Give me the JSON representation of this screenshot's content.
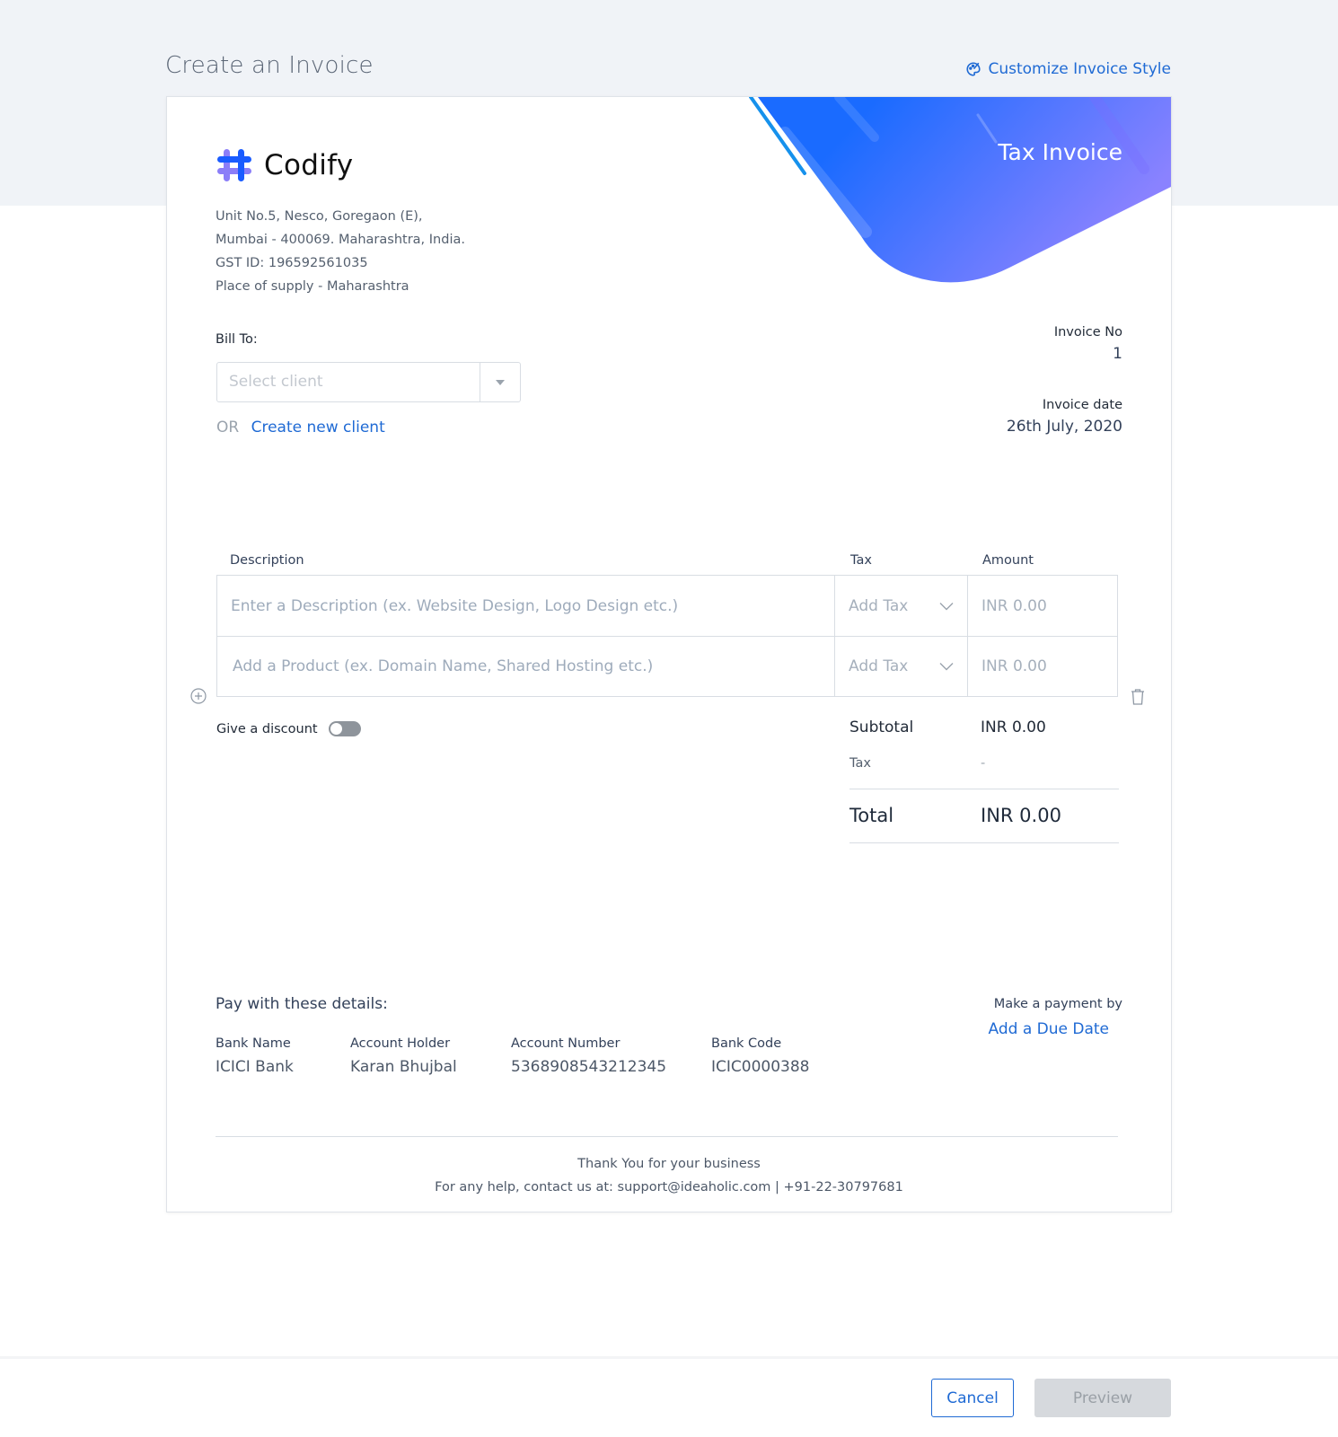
{
  "header": {
    "title": "Create an Invoice",
    "customize_link": "Customize Invoice Style",
    "customize_icon": "palette-icon"
  },
  "invoice": {
    "banner_title": "Tax Invoice",
    "colors": {
      "accent": "#1f6ad4",
      "banner_start": "#1a6bff",
      "banner_end": "#8a82ff"
    },
    "company": {
      "name": "Codify",
      "logo_icon": "hash-logo-icon",
      "address_lines": [
        "Unit No.5, Nesco, Goregaon (E),",
        "Mumbai - 400069. Maharashtra, India.",
        "GST ID: 196592561035",
        "Place of supply - Maharashtra"
      ]
    },
    "bill_to": {
      "label": "Bill To:",
      "select_placeholder": "Select client",
      "or_text": "OR",
      "create_client_link": "Create new client"
    },
    "meta": {
      "invoice_no_label": "Invoice No",
      "invoice_no_value": "1",
      "invoice_date_label": "Invoice date",
      "invoice_date_value": "26th July, 2020"
    },
    "items": {
      "headers": {
        "description": "Description",
        "tax": "Tax",
        "amount": "Amount"
      },
      "rows": [
        {
          "description_placeholder": "Enter a Description (ex. Website Design, Logo Design etc.)",
          "tax_placeholder": "Add Tax",
          "amount_placeholder": "INR 0.00"
        },
        {
          "description_placeholder": "Add a Product (ex. Domain Name, Shared Hosting etc.)",
          "tax_placeholder": "Add Tax",
          "amount_placeholder": "INR 0.00"
        }
      ],
      "add_row_icon": "plus-circle-icon",
      "delete_row_icon": "trash-icon"
    },
    "discount": {
      "label": "Give a discount",
      "enabled": false
    },
    "totals": {
      "subtotal_label": "Subtotal",
      "subtotal_value": "INR 0.00",
      "tax_label": "Tax",
      "tax_value": "-",
      "total_label": "Total",
      "total_value": "INR 0.00"
    },
    "payment": {
      "title": "Pay with these details:",
      "bank_name_label": "Bank Name",
      "bank_name_value": "ICICI Bank",
      "account_holder_label": "Account Holder",
      "account_holder_value": "Karan Bhujbal",
      "account_number_label": "Account Number",
      "account_number_value": "5368908543212345",
      "bank_code_label": "Bank Code",
      "bank_code_value": "ICIC0000388",
      "due_label": "Make a payment by",
      "due_link": "Add a Due Date"
    },
    "footer": {
      "thanks": "Thank You for your business",
      "contact": "For any help, contact us at: support@ideaholic.com | +91-22-30797681"
    }
  },
  "actions": {
    "cancel_label": "Cancel",
    "preview_label": "Preview"
  }
}
